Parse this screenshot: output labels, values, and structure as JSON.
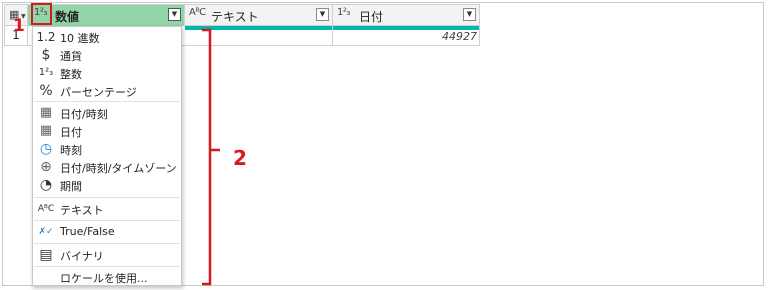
{
  "table": {
    "columns": [
      {
        "type_icon": "1²₃",
        "name": "数値"
      },
      {
        "type_icon": "AᴮC",
        "name": "テキスト"
      },
      {
        "type_icon": "1²₃",
        "name": "日付"
      }
    ],
    "rows": [
      {
        "row_number": "1",
        "date_value": "44927"
      }
    ]
  },
  "menu": {
    "items": [
      {
        "icon": "decimal-icon",
        "glyph": "1.2",
        "label": "10 進数"
      },
      {
        "icon": "dollar-icon",
        "glyph": "$",
        "label": "通貨"
      },
      {
        "icon": "integer-icon",
        "glyph": "1²₃",
        "label": "整数"
      },
      {
        "icon": "percent-icon",
        "glyph": "%",
        "label": "パーセンテージ"
      },
      {
        "icon": "datetime-icon",
        "glyph": "▦",
        "label": "日付/時刻"
      },
      {
        "icon": "calendar-icon",
        "glyph": "▦",
        "label": "日付"
      },
      {
        "icon": "clock-icon",
        "glyph": "◷",
        "label": "時刻"
      },
      {
        "icon": "globe-icon",
        "glyph": "⊕",
        "label": "日付/時刻/タイムゾーン"
      },
      {
        "icon": "stopwatch-icon",
        "glyph": "◔",
        "label": "期間"
      },
      {
        "icon": "text-icon",
        "glyph": "AᴮC",
        "label": "テキスト"
      },
      {
        "icon": "truefalse-icon",
        "glyph": "✗✓",
        "label": "True/False"
      },
      {
        "icon": "binary-icon",
        "glyph": "▤",
        "label": "バイナリ"
      },
      {
        "icon": "",
        "glyph": "",
        "label": "ロケールを使用..."
      }
    ]
  },
  "callouts": {
    "one": "1",
    "two": "2"
  },
  "colors": {
    "accent_red": "#d7191f",
    "header_green": "#91d5a8",
    "teal": "#01b8aa"
  }
}
